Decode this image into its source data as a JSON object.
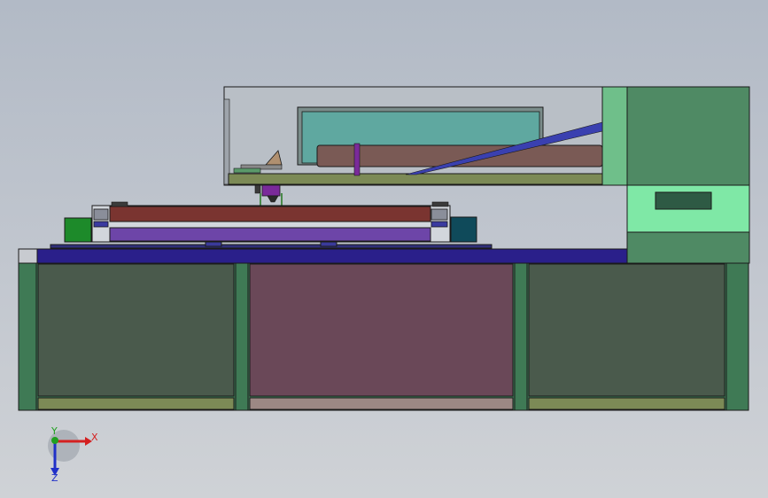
{
  "viewport": {
    "background_top": "#b2bac6",
    "background_bottom": "#cfd2d6"
  },
  "model": {
    "colors": {
      "outline": "#1a1a1a",
      "cabinet_frame": "#3f7a55",
      "cabinet_panel": "#4a5a4c",
      "cabinet_center_panel": "#6a4858",
      "cabinet_base_strip": "#7c8a56",
      "cabinet_center_base": "#9c8884",
      "tower_upper": "#4f8a64",
      "tower_light": "#6fbf8a",
      "tower_window": "#7fe8a6",
      "tower_slot": "#2e5a44",
      "worktable": "#2a1f8a",
      "bed_upper": "#7a3430",
      "bed_lower": "#6d45a8",
      "gantry_enclosure": "#b9bfc6",
      "glass_panel": "#5fa8a0",
      "laser_tube": "#7a5a55",
      "diagonal_rail": "#3a40b0",
      "green_block": "#1d8a2a",
      "teal_block": "#0f4a5a",
      "head_purple": "#7a2a9a"
    }
  },
  "triad": {
    "x_label": "X",
    "y_label": "Y",
    "z_label": "Z",
    "x_color": "#d42020",
    "y_color": "#20a020",
    "z_color": "#2030c8"
  }
}
